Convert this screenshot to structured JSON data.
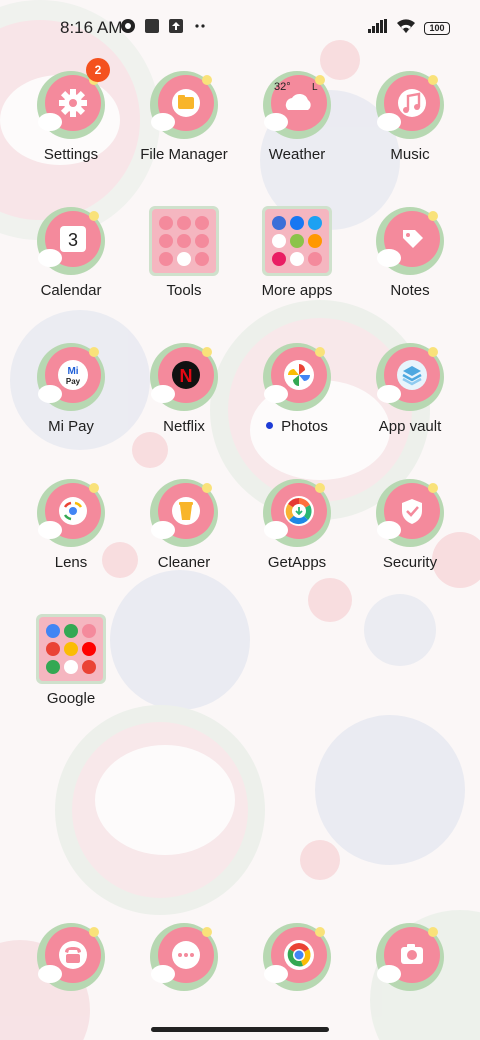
{
  "status_bar": {
    "time": "8:16 AM",
    "battery": "100"
  },
  "apps": [
    {
      "label": "Settings",
      "icon": "gear-icon",
      "badge": "2"
    },
    {
      "label": "File Manager",
      "icon": "folder-icon"
    },
    {
      "label": "Weather",
      "icon": "weather-icon",
      "temp": "32°",
      "unit": "L"
    },
    {
      "label": "Music",
      "icon": "music-note-icon"
    },
    {
      "label": "Calendar",
      "icon": "calendar-icon",
      "day": "3"
    },
    {
      "label": "Tools",
      "icon": "folder-grid-icon"
    },
    {
      "label": "More apps",
      "icon": "folder-grid-icon"
    },
    {
      "label": "Notes",
      "icon": "tag-icon"
    },
    {
      "label": "Mi Pay",
      "icon": "mi-pay-icon",
      "mi": "Mi",
      "pay": "Pay"
    },
    {
      "label": "Netflix",
      "icon": "netflix-icon",
      "letter": "N"
    },
    {
      "label": "Photos",
      "icon": "photos-pinwheel-icon",
      "new_dot": true
    },
    {
      "label": "App vault",
      "icon": "app-vault-icon"
    },
    {
      "label": "Lens",
      "icon": "lens-icon"
    },
    {
      "label": "Cleaner",
      "icon": "trash-can-icon"
    },
    {
      "label": "GetApps",
      "icon": "getapps-icon"
    },
    {
      "label": "Security",
      "icon": "shield-check-icon"
    },
    {
      "label": "Google",
      "icon": "folder-grid-icon"
    }
  ],
  "dock": [
    {
      "icon": "phone-icon"
    },
    {
      "icon": "messages-icon"
    },
    {
      "icon": "chrome-icon"
    },
    {
      "icon": "camera-icon"
    }
  ],
  "colors": {
    "icon_pink": "#f48a9c",
    "icon_green": "#b7d8b2",
    "badge": "#f4511e"
  }
}
